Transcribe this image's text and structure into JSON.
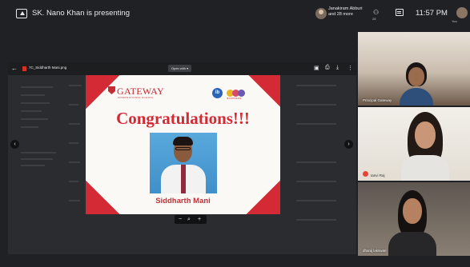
{
  "topbar": {
    "presenting_text": "SK. Nano Khan is presenting",
    "host_text_line1": "Janakiram Abburi",
    "host_text_line2": "and 28 more",
    "people_count_sub": "28",
    "clock": "11:57 PM",
    "self_label": "You"
  },
  "viewer": {
    "file_name": "7C_Siddharth Mani.png",
    "open_with_label": "Open with",
    "tools": [
      "comment-icon",
      "print-icon",
      "download-icon",
      "more-vert-icon"
    ]
  },
  "certificate": {
    "logo_text": "GATEWAY",
    "logo_subtext": "INTERNATIONAL SCHOOL",
    "ib_text": "ib",
    "dots_caption": "IB CONTINUUM",
    "heading": "Congratulations!!!",
    "student_name": "Siddharth Mani",
    "dot_colors": [
      "#e9b623",
      "#d84a6b",
      "#6b58b0"
    ]
  },
  "zoom": {
    "minus": "−",
    "search": "⌕",
    "plus": "+"
  },
  "participants": [
    {
      "name": "Principal Gateway"
    },
    {
      "name": "tanvi Raj"
    },
    {
      "name": "dhanij lakswari"
    }
  ],
  "colors": {
    "brand_red": "#d42a35",
    "meet_bg": "#202124"
  }
}
